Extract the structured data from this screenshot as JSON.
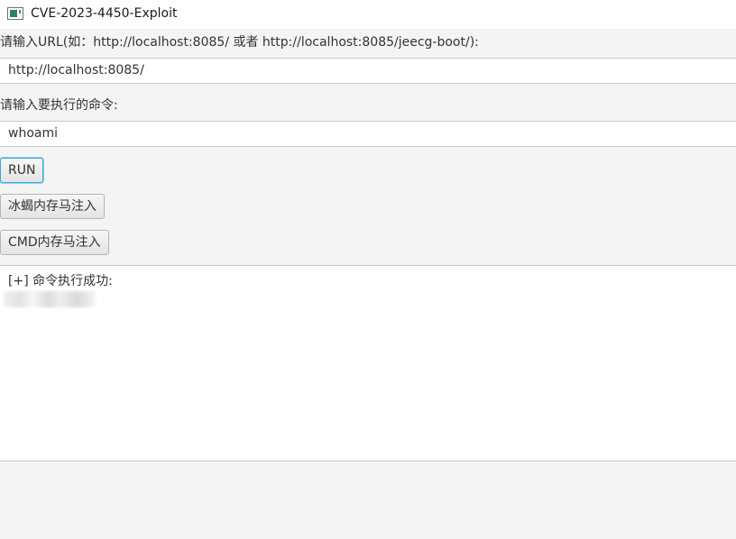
{
  "window": {
    "title": "CVE-2023-4450-Exploit",
    "icon": "java-app-icon"
  },
  "form": {
    "url_label": "请输入URL(如：http://localhost:8085/ 或者 http://localhost:8085/jeecg-boot/):",
    "url_value": "http://localhost:8085/",
    "command_label": "请输入要执行的命令:",
    "command_value": "whoami"
  },
  "buttons": {
    "run": "RUN",
    "behinder_inject": "冰蝎内存马注入",
    "cmd_inject": "CMD内存马注入"
  },
  "output": {
    "line1": "[+] 命令执行成功:"
  },
  "colors": {
    "focus_border": "#3aa6dd",
    "window_bg": "#f4f4f4"
  }
}
